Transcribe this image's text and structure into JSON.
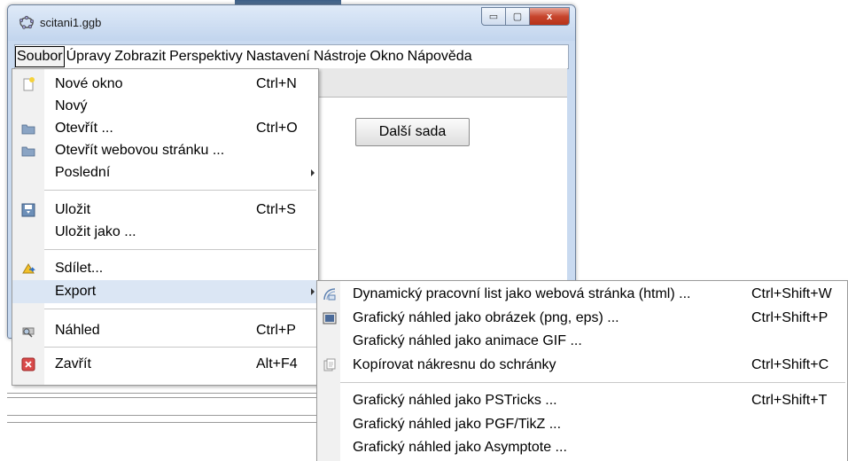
{
  "window": {
    "title": "scitani1.ggb",
    "minimize_glyph": "▭",
    "maximize_glyph": "▢",
    "close_glyph": "x"
  },
  "menubar": [
    {
      "label": "Soubor"
    },
    {
      "label": "Úpravy"
    },
    {
      "label": "Zobrazit"
    },
    {
      "label": "Perspektivy"
    },
    {
      "label": "Nastavení"
    },
    {
      "label": "Nástroje"
    },
    {
      "label": "Okno"
    },
    {
      "label": "Nápověda"
    }
  ],
  "content": {
    "next_button_label": "Další sada"
  },
  "file_menu": [
    {
      "label": "Nové okno",
      "shortcut": "Ctrl+N",
      "icon": "new-window-icon"
    },
    {
      "label": "Nový",
      "shortcut": "",
      "icon": ""
    },
    {
      "label": "Otevřít ...",
      "shortcut": "Ctrl+O",
      "icon": "folder-icon"
    },
    {
      "label": "Otevřít webovou stránku ...",
      "shortcut": "",
      "icon": "folder-icon"
    },
    {
      "label": "Poslední",
      "shortcut": "",
      "icon": "",
      "submenu": true
    },
    {
      "label": "Uložit",
      "shortcut": "Ctrl+S",
      "icon": "save-icon"
    },
    {
      "label": "Uložit jako ...",
      "shortcut": "",
      "icon": ""
    },
    {
      "label": "Sdílet...",
      "shortcut": "",
      "icon": "share-icon"
    },
    {
      "label": "Export",
      "shortcut": "",
      "icon": "",
      "submenu": true,
      "active": true
    },
    {
      "label": "Náhled",
      "shortcut": "Ctrl+P",
      "icon": "print-preview-icon"
    },
    {
      "label": "Zavřít",
      "shortcut": "Alt+F4",
      "icon": "close-icon"
    }
  ],
  "export_menu": [
    {
      "label": "Dynamický pracovní list jako webová stránka (html) ...",
      "shortcut": "Ctrl+Shift+W",
      "icon": "html-export-icon"
    },
    {
      "label": "Grafický náhled jako obrázek (png, eps) ...",
      "shortcut": "Ctrl+Shift+P",
      "icon": "image-export-icon"
    },
    {
      "label": "Grafický náhled jako animace GIF ...",
      "shortcut": "",
      "icon": ""
    },
    {
      "label": "Kopírovat nákresnu do schránky",
      "shortcut": "Ctrl+Shift+C",
      "icon": "clipboard-icon"
    },
    {
      "label": "Grafický náhled jako PSTricks ...",
      "shortcut": "Ctrl+Shift+T",
      "icon": ""
    },
    {
      "label": "Grafický náhled jako PGF/TikZ ...",
      "shortcut": "",
      "icon": ""
    },
    {
      "label": "Grafický náhled jako Asymptote ...",
      "shortcut": "",
      "icon": ""
    }
  ]
}
